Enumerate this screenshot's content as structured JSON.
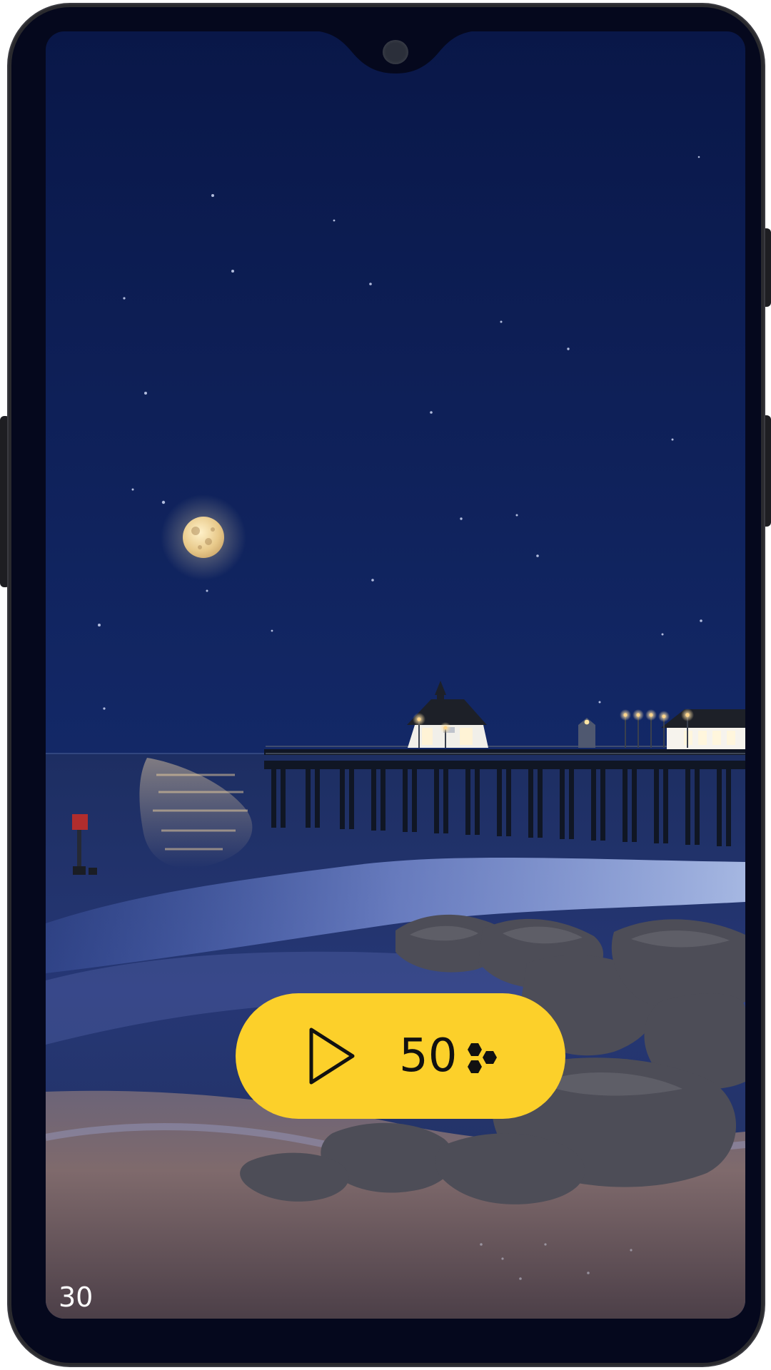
{
  "colors": {
    "frame": "#05081d",
    "accent_button": "#fcd02a",
    "label_text": "#ffffff"
  },
  "icons": {
    "play": "play-icon",
    "currency": "hexagon-cluster-icon"
  },
  "main": {
    "play_button": {
      "cost": "50"
    },
    "corner_counter": "30"
  }
}
